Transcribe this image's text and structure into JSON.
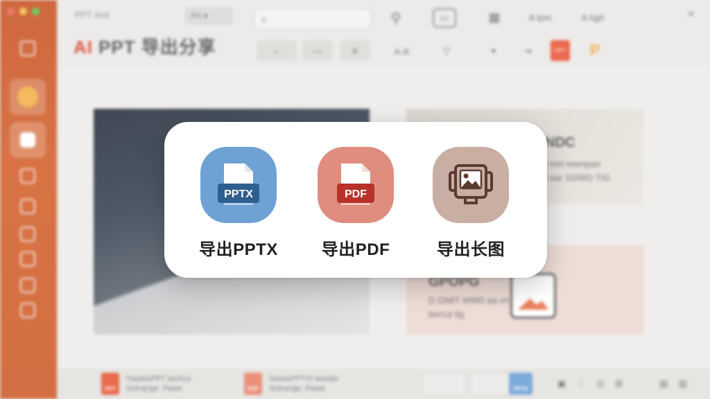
{
  "window": {
    "tab_title": "PPT test",
    "mini_select": "Pri",
    "search_placeholder": "ı|",
    "toolbar_text_1": "A lpm",
    "toolbar_text_2": "A hgh",
    "app_title_ai": "AI",
    "app_title_rest": "PPT 导出分享",
    "close_glyph": "×"
  },
  "slide": {
    "card1_heading": "NDC",
    "card1_line1": "t rnrt rewnpan",
    "card1_line2": "t sar 10/WG TIG",
    "card2_heading": "GPOPG",
    "card2_line1": "D GMIT WW0 aa vn artoto",
    "card2_line2": "berrut tlg"
  },
  "file_strip": {
    "files": [
      {
        "icon_label": "PPT",
        "name": "OaafesPPT teuhca",
        "meta": "Solnange. Ftaoe"
      },
      {
        "icon_label": "PDF",
        "name": "OeessPPTXI teetato",
        "meta": "Solnange. Ftaoe"
      },
      {
        "icon_label": "PPTS",
        "name": "",
        "meta": ""
      }
    ]
  },
  "export_modal": {
    "options": [
      {
        "label": "导出PPTX",
        "icon_text": "PPTX",
        "icon": "pptx-file-icon",
        "bg": "#6ea1d4",
        "badge": "#2f5f8d"
      },
      {
        "label": "导出PDF",
        "icon_text": "PDF",
        "icon": "pdf-file-icon",
        "bg": "#de8d7e",
        "badge": "#b8322a"
      },
      {
        "label": "导出长图",
        "icon_text": "",
        "icon": "long-image-icon",
        "bg": "#c9aea3",
        "badge": "#5b3b31"
      }
    ]
  },
  "colors": {
    "accent": "#d9452a",
    "rail": "#cc5a2c"
  }
}
